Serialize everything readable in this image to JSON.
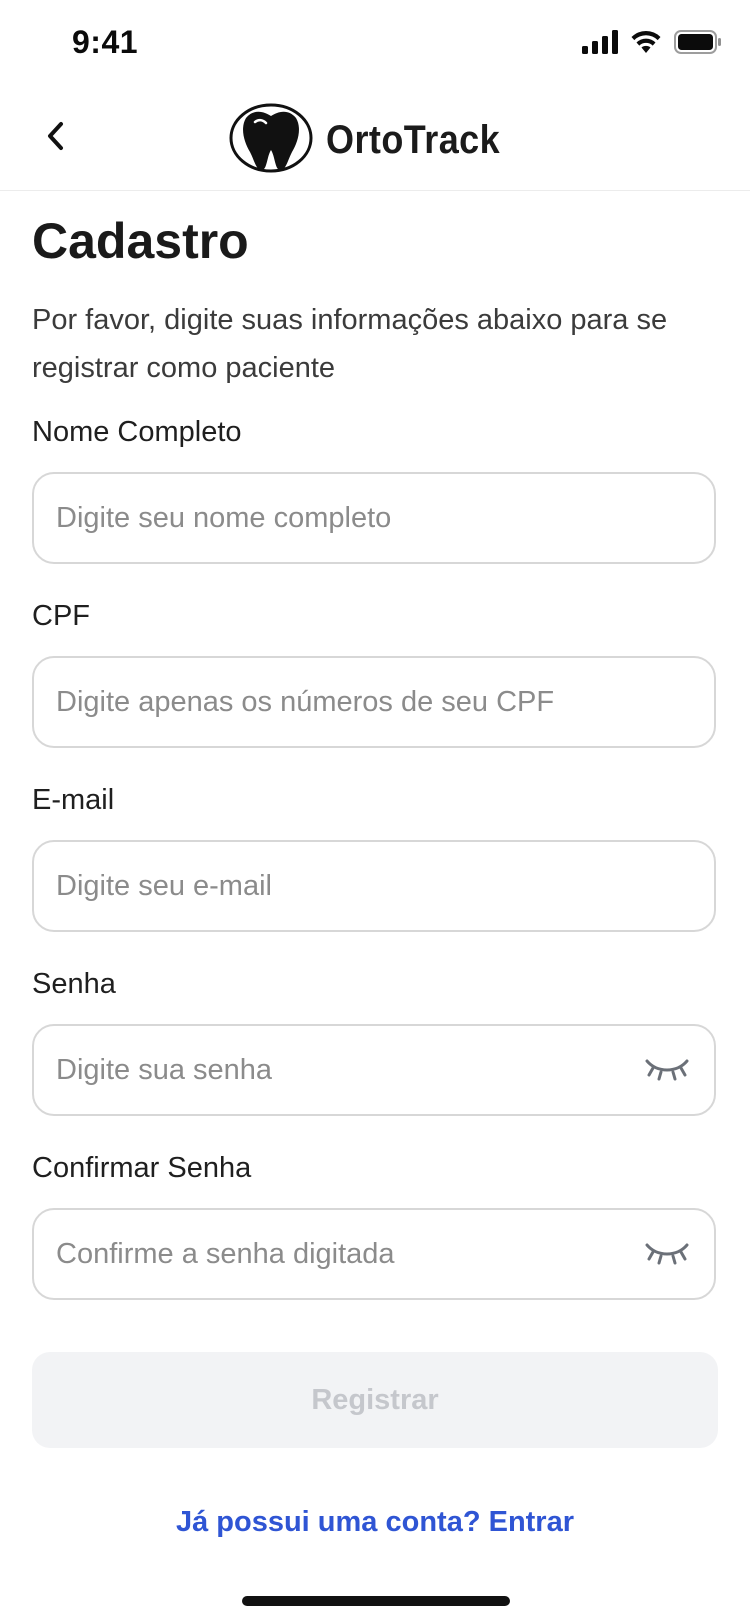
{
  "status_bar": {
    "time": "9:41",
    "icons": [
      "cellular-signal-icon",
      "wifi-icon",
      "battery-icon"
    ]
  },
  "nav": {
    "back_icon": "chevron-left-icon",
    "logo_icon": "tooth-icon",
    "brand": "OrtoTrack"
  },
  "page": {
    "title": "Cadastro",
    "subtitle": "Por favor, digite suas informações abaixo para se registrar como paciente"
  },
  "form": {
    "fields": [
      {
        "label": "Nome Completo",
        "placeholder": "Digite seu nome completo",
        "value": ""
      },
      {
        "label": "CPF",
        "placeholder": "Digite apenas os números de seu CPF",
        "value": ""
      },
      {
        "label": "E-mail",
        "placeholder": "Digite seu e-mail",
        "value": ""
      },
      {
        "label": "Senha",
        "placeholder": "Digite sua senha",
        "value": "",
        "toggle_icon": "eye-closed-icon"
      },
      {
        "label": "Confirmar Senha",
        "placeholder": "Confirme a senha digitada",
        "value": "",
        "toggle_icon": "eye-closed-icon"
      }
    ],
    "submit_label": "Registrar",
    "submit_disabled": true
  },
  "footer": {
    "login_link": "Já possui uma conta? Entrar"
  },
  "colors": {
    "accent": "#2F55D4",
    "button_disabled_bg": "#F2F3F5",
    "button_disabled_text": "#C5C7CC",
    "input_border": "#D7D7D7",
    "placeholder": "#8B8B8B"
  }
}
